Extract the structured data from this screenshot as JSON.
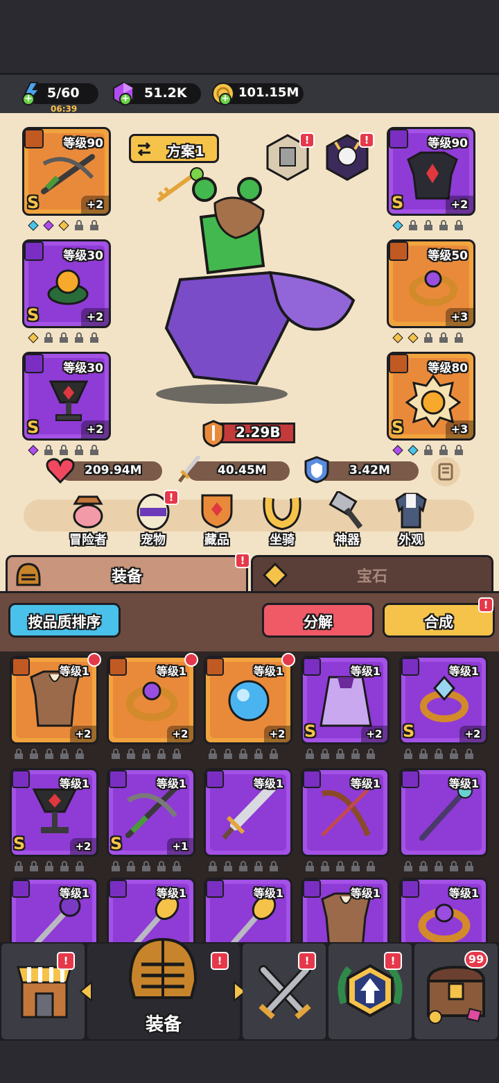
{
  "resources": {
    "energy": {
      "value": "5/60",
      "timer": "06:39",
      "icon": "lightning-icon"
    },
    "gems": {
      "value": "51.2K",
      "icon": "purple-gem-icon"
    },
    "gold": {
      "value": "101.15M",
      "icon": "gold-coin-icon"
    }
  },
  "plan_button": {
    "label": "方案1"
  },
  "equipped": {
    "weapon": {
      "level": "等级90",
      "grade": "S",
      "plus": "+2",
      "icon": "crossbow-icon"
    },
    "ring_left": {
      "level": "等级30",
      "grade": "S",
      "plus": "+2",
      "icon": "fire-ring-icon"
    },
    "amulet": {
      "level": "等级30",
      "grade": "S",
      "plus": "+2",
      "icon": "ruby-goblet-icon"
    },
    "armor": {
      "level": "等级90",
      "grade": "S",
      "plus": "+2",
      "icon": "dark-armor-icon"
    },
    "ring_right": {
      "level": "等级50",
      "grade": "",
      "plus": "+3",
      "icon": "purple-ring-icon"
    },
    "medal": {
      "level": "等级80",
      "grade": "S",
      "plus": "+3",
      "icon": "sun-medal-icon"
    }
  },
  "power": {
    "value": "2.29B"
  },
  "stats": {
    "hp": "209.94M",
    "attack": "40.45M",
    "defense": "3.42M"
  },
  "nav": [
    {
      "label": "冒险者",
      "icon": "adventurer-icon"
    },
    {
      "label": "宠物",
      "icon": "pet-egg-icon"
    },
    {
      "label": "藏品",
      "icon": "collection-icon"
    },
    {
      "label": "坐骑",
      "icon": "horseshoe-icon"
    },
    {
      "label": "神器",
      "icon": "hammer-icon"
    },
    {
      "label": "外观",
      "icon": "outfit-icon"
    }
  ],
  "tabs": {
    "equipment": "装备",
    "gems": "宝石"
  },
  "actions": {
    "sort": "按品质排序",
    "dismantle": "分解",
    "merge": "合成"
  },
  "inventory": [
    {
      "color": "orange",
      "level": "等级1",
      "grade": "",
      "plus": "+2",
      "icon": "leather-armor-icon"
    },
    {
      "color": "orange",
      "level": "等级1",
      "grade": "",
      "plus": "+2",
      "icon": "purple-ring-icon"
    },
    {
      "color": "orange",
      "level": "等级1",
      "grade": "",
      "plus": "+2",
      "icon": "blue-orb-icon"
    },
    {
      "color": "purple",
      "level": "等级1",
      "grade": "S",
      "plus": "+2",
      "icon": "purple-cape-icon"
    },
    {
      "color": "purple",
      "level": "等级1",
      "grade": "S",
      "plus": "+2",
      "icon": "crystal-ring-icon"
    },
    {
      "color": "purple",
      "level": "等级1",
      "grade": "S",
      "plus": "+2",
      "icon": "ruby-goblet-icon"
    },
    {
      "color": "purple",
      "level": "等级1",
      "grade": "S",
      "plus": "+1",
      "icon": "crossbow-icon"
    },
    {
      "color": "purple",
      "level": "等级1",
      "grade": "",
      "plus": "",
      "icon": "sword-icon"
    },
    {
      "color": "purple",
      "level": "等级1",
      "grade": "",
      "plus": "",
      "icon": "bow-icon"
    },
    {
      "color": "purple",
      "level": "等级1",
      "grade": "",
      "plus": "",
      "icon": "staff-icon"
    },
    {
      "color": "purple",
      "level": "等级1",
      "grade": "",
      "plus": "",
      "icon": "orb-staff-icon"
    },
    {
      "color": "purple",
      "level": "等级1",
      "grade": "",
      "plus": "",
      "icon": "hammer-icon"
    },
    {
      "color": "purple",
      "level": "等级1",
      "grade": "",
      "plus": "",
      "icon": "hammer-icon"
    },
    {
      "color": "purple",
      "level": "等级1",
      "grade": "",
      "plus": "",
      "icon": "leather-armor-icon"
    },
    {
      "color": "purple",
      "level": "等级1",
      "grade": "",
      "plus": "",
      "icon": "purple-ring-icon"
    }
  ],
  "bottom_nav": {
    "active_label": "装备",
    "chest_count": "99"
  },
  "colors": {
    "orange": "#f1a43e",
    "purple": "#a451e6",
    "alert": "#e5394b",
    "gold": "#f6c34a"
  }
}
